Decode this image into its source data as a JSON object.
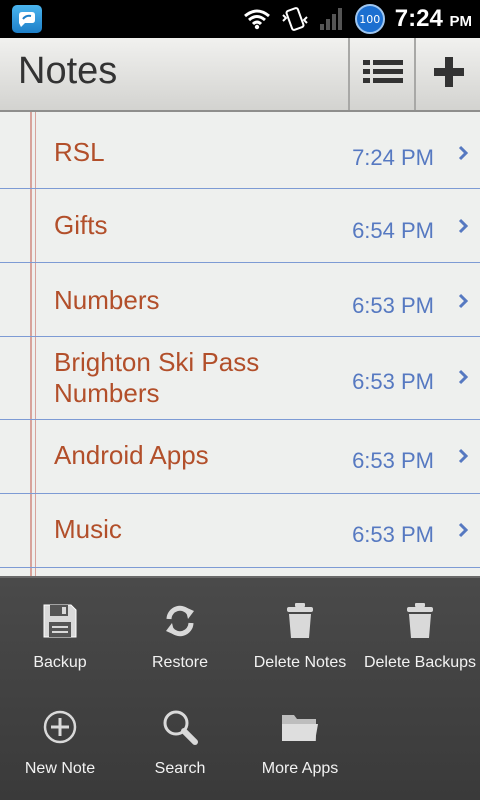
{
  "status_bar": {
    "time": "7:24",
    "ampm": "PM",
    "battery": "100",
    "icons": [
      "app-notification-icon",
      "wifi-icon",
      "vibrate-icon",
      "signal-icon",
      "battery-icon"
    ]
  },
  "header": {
    "title": "Notes",
    "list_icon": "list-icon",
    "add_icon": "plus-icon"
  },
  "notes": [
    {
      "title": "RSL",
      "time": "7:24 PM"
    },
    {
      "title": "Gifts",
      "time": "6:54 PM"
    },
    {
      "title": "Numbers",
      "time": "6:53 PM"
    },
    {
      "title": "Brighton Ski Pass Numbers",
      "time": "6:53 PM"
    },
    {
      "title": "Android Apps",
      "time": "6:53 PM"
    },
    {
      "title": "Music",
      "time": "6:53 PM"
    }
  ],
  "menu": {
    "items": [
      {
        "label": "Backup",
        "icon": "floppy-disk-icon"
      },
      {
        "label": "Restore",
        "icon": "refresh-icon"
      },
      {
        "label": "Delete Notes",
        "icon": "trash-icon"
      },
      {
        "label": "Delete Backups",
        "icon": "trash-icon"
      },
      {
        "label": "New Note",
        "icon": "add-circle-icon"
      },
      {
        "label": "Search",
        "icon": "search-icon"
      },
      {
        "label": "More Apps",
        "icon": "folder-icon"
      }
    ]
  },
  "colors": {
    "note_title": "#b24f2a",
    "note_time": "#5679c1",
    "rule_line": "#7d9bd4",
    "menu_bg": "#424242"
  }
}
